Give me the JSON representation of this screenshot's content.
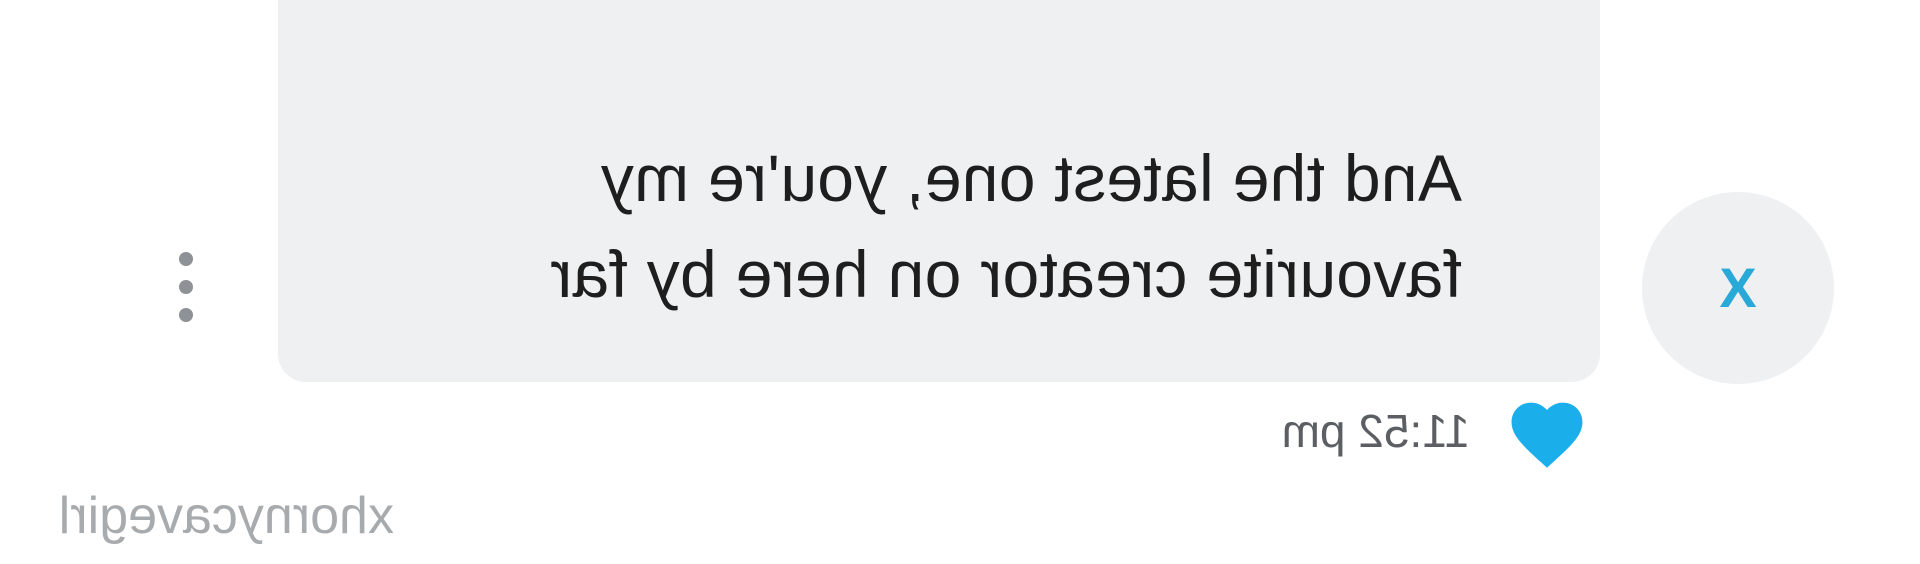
{
  "message": {
    "text": "And the latest one, you're my\nfavourite creator on here by far",
    "time": "11:52 pm",
    "liked": true
  },
  "sender": {
    "avatar_letter": "X",
    "avatar_letter_color": "#29a9d8"
  },
  "icons": {
    "like": "heart-icon",
    "menu": "more-vertical-icon"
  },
  "colors": {
    "heart": "#1aaeea",
    "bubble": "#eff0f2"
  },
  "watermark": "xhornycavegirl",
  "mirrored": true
}
